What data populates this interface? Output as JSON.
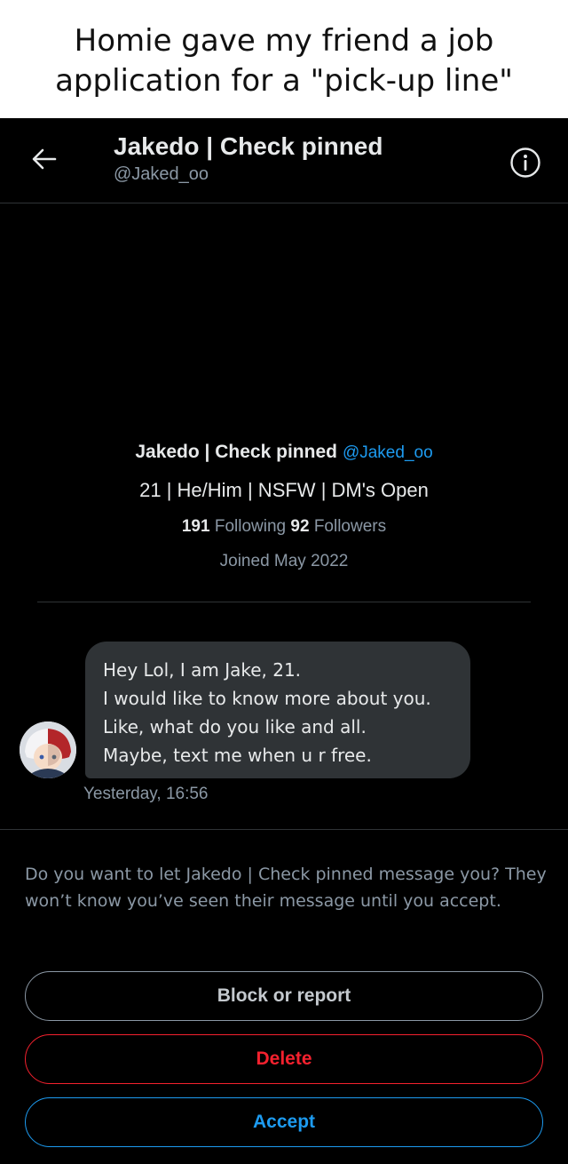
{
  "caption": {
    "line1": "Homie gave my friend a job",
    "line2": "application for a \"pick-up line\""
  },
  "header": {
    "title": "Jakedo | Check pinned",
    "handle": "@Jaked_oo",
    "back_icon": "arrow-left-icon",
    "info_icon": "info-circle-icon"
  },
  "profile": {
    "name": "Jakedo | Check pinned",
    "handle": "@Jaked_oo",
    "bio": "21 | He/Him | NSFW | DM's Open",
    "following_count": "191",
    "following_label": "Following",
    "followers_count": "92",
    "followers_label": "Followers",
    "joined": "Joined May 2022"
  },
  "message": {
    "lines": [
      "Hey Lol, I am Jake, 21.",
      "I would like to know more about you.",
      "Like, what do you like and all.",
      "Maybe, text me when u r free."
    ],
    "timestamp": "Yesterday, 16:56"
  },
  "request": {
    "text": "Do you want to let Jakedo | Check pinned message you? They won’t know you’ve seen their message until you accept."
  },
  "actions": {
    "block_label": "Block or report",
    "delete_label": "Delete",
    "accept_label": "Accept"
  },
  "colors": {
    "background": "#000000",
    "link": "#1d9bf0",
    "danger": "#f4212e",
    "bubble": "#2f3336",
    "muted": "#8b98a5"
  }
}
